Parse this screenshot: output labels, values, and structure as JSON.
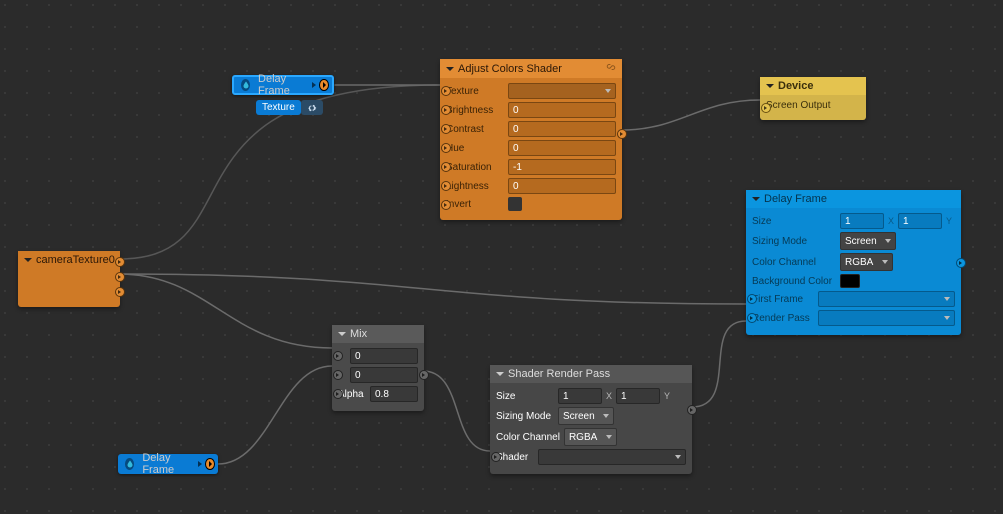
{
  "labels": {
    "axisX": "X",
    "axisY": "Y"
  },
  "nodes": {
    "delayFramePillTop": {
      "title": "Delay Frame",
      "badge": "Texture"
    },
    "delayFramePillBottom": {
      "title": "Delay Frame"
    },
    "adjustColors": {
      "title": "Adjust Colors Shader",
      "props": {
        "texture": {
          "label": "Texture"
        },
        "brightness": {
          "label": "Brightness",
          "value": "0"
        },
        "contrast": {
          "label": "Contrast",
          "value": "0"
        },
        "hue": {
          "label": "Hue",
          "value": "0"
        },
        "saturation": {
          "label": "Saturation",
          "value": "-1"
        },
        "lightness": {
          "label": "Lightness",
          "value": "0"
        },
        "invert": {
          "label": "Invert",
          "value": false
        }
      }
    },
    "device": {
      "title": "Device",
      "props": {
        "screenOutput": {
          "label": "Screen Output"
        }
      }
    },
    "cameraTexture": {
      "title": "cameraTexture0"
    },
    "mix": {
      "title": "Mix",
      "props": {
        "inputA": {
          "value": "0"
        },
        "inputB": {
          "value": "0"
        },
        "alpha": {
          "label": "Alpha",
          "value": "0.8"
        }
      }
    },
    "shaderRenderPass": {
      "title": "Shader Render Pass",
      "props": {
        "size": {
          "label": "Size",
          "x": "1",
          "y": "1"
        },
        "sizingMode": {
          "label": "Sizing Mode",
          "value": "Screen"
        },
        "colorChannel": {
          "label": "Color Channel",
          "value": "RGBA"
        },
        "shader": {
          "label": "Shader"
        }
      }
    },
    "delayFrame": {
      "title": "Delay Frame",
      "props": {
        "size": {
          "label": "Size",
          "x": "1",
          "y": "1"
        },
        "sizingMode": {
          "label": "Sizing Mode",
          "value": "Screen"
        },
        "colorChannel": {
          "label": "Color Channel",
          "value": "RGBA"
        },
        "bgColor": {
          "label": "Background Color",
          "value": "#000000"
        },
        "firstFrame": {
          "label": "First Frame"
        },
        "renderPass": {
          "label": "Render Pass"
        }
      }
    }
  }
}
